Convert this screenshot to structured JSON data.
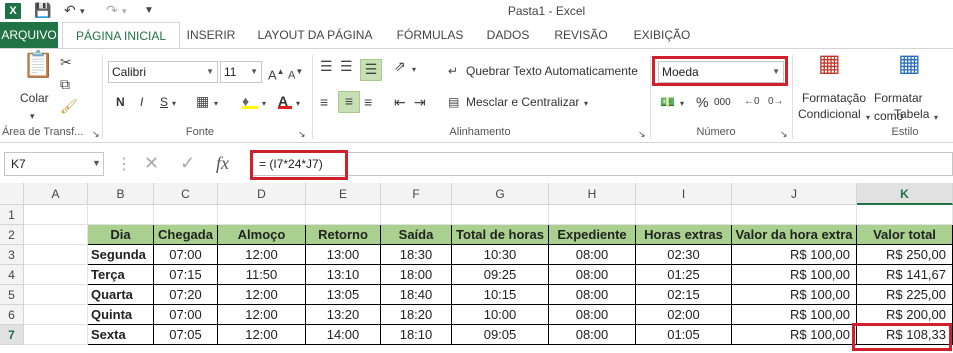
{
  "window": {
    "title": "Pasta1 - Excel"
  },
  "quick_access": {
    "save_icon": "save-icon",
    "undo_icon": "undo-icon",
    "redo_icon": "redo-icon",
    "customize_icon": "customize-icon"
  },
  "tabs": [
    {
      "label": "ARQUIVO"
    },
    {
      "label": "PÁGINA INICIAL"
    },
    {
      "label": "INSERIR"
    },
    {
      "label": "LAYOUT DA PÁGINA"
    },
    {
      "label": "FÓRMULAS"
    },
    {
      "label": "DADOS"
    },
    {
      "label": "REVISÃO"
    },
    {
      "label": "EXIBIÇÃO"
    }
  ],
  "ribbon": {
    "clipboard": {
      "paste_label": "Colar",
      "group_label": "Área de Transf..."
    },
    "font": {
      "name": "Calibri",
      "size": "11",
      "bold": "N",
      "italic": "I",
      "underline": "S",
      "group_label": "Fonte"
    },
    "alignment": {
      "wrap_label": "Quebrar Texto Automaticamente",
      "merge_label": "Mesclar e Centralizar",
      "group_label": "Alinhamento"
    },
    "number": {
      "format": "Moeda",
      "group_label": "Número",
      "percent": "%",
      "thousands": "000"
    },
    "styles": {
      "conditional_line1": "Formatação",
      "conditional_line2": "Condicional",
      "table_line1": "Formatar como",
      "table_line2": "Tabela",
      "group_label": "Estilo"
    }
  },
  "formula_bar": {
    "name_box": "K7",
    "formula": "= (I7*24*J7)",
    "fx": "fx"
  },
  "grid": {
    "columns": [
      "A",
      "B",
      "C",
      "D",
      "E",
      "F",
      "G",
      "H",
      "I",
      "J",
      "K"
    ],
    "rows": [
      "1",
      "2",
      "3",
      "4",
      "5",
      "6",
      "7"
    ],
    "selected_cell": "K7",
    "header": [
      "Dia",
      "Chegada",
      "Almoço",
      "Retorno",
      "Saída",
      "Total de horas",
      "Expediente",
      "Horas extras",
      "Valor da hora extra",
      "Valor total"
    ],
    "data": [
      [
        "Segunda",
        "07:00",
        "12:00",
        "13:00",
        "18:30",
        "10:30",
        "08:00",
        "02:30",
        "R$ 100,00",
        "R$ 250,00"
      ],
      [
        "Terça",
        "07:15",
        "11:50",
        "13:10",
        "18:00",
        "09:25",
        "08:00",
        "01:25",
        "R$ 100,00",
        "R$ 141,67"
      ],
      [
        "Quarta",
        "07:20",
        "12:00",
        "13:05",
        "18:40",
        "10:15",
        "08:00",
        "02:15",
        "R$ 100,00",
        "R$ 225,00"
      ],
      [
        "Quinta",
        "07:00",
        "12:00",
        "13:20",
        "18:20",
        "10:00",
        "08:00",
        "02:00",
        "R$ 100,00",
        "R$ 200,00"
      ],
      [
        "Sexta",
        "07:05",
        "12:00",
        "14:00",
        "18:10",
        "09:05",
        "08:00",
        "01:05",
        "R$ 100,00",
        "R$ 108,33"
      ]
    ]
  },
  "colors": {
    "accent": "#217346",
    "header_fill": "#a9d08e",
    "highlight": "#d0202e"
  }
}
